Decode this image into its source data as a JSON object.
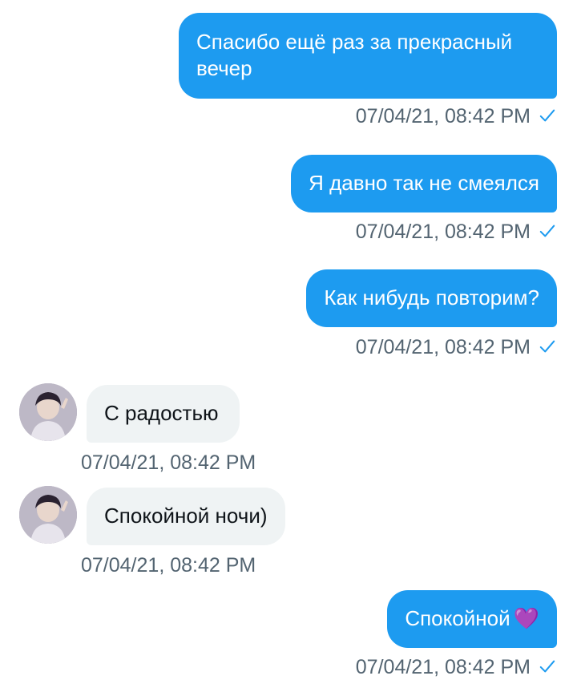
{
  "colors": {
    "outgoing_bubble": "#1d9bf0",
    "incoming_bubble": "#eff3f4",
    "timestamp_text": "#536471",
    "read_check": "#1d9bf0",
    "heart": "#7a3fb8"
  },
  "messages": [
    {
      "direction": "outgoing",
      "text": "Спасибо ещё раз за прекрасный вечер",
      "timestamp": "07/04/21, 08:42 PM",
      "read_icon": "checkmark-icon"
    },
    {
      "direction": "outgoing",
      "text": "Я давно так не смеялся",
      "timestamp": "07/04/21, 08:42 PM",
      "read_icon": "checkmark-icon"
    },
    {
      "direction": "outgoing",
      "text": "Как нибудь повторим?",
      "timestamp": "07/04/21, 08:42 PM",
      "read_icon": "checkmark-icon"
    },
    {
      "direction": "incoming",
      "text": "С радостью",
      "timestamp": "07/04/21, 08:42 PM",
      "avatar_icon": "user-avatar"
    },
    {
      "direction": "incoming",
      "text": "Спокойной ночи)",
      "timestamp": "07/04/21, 08:42 PM",
      "avatar_icon": "user-avatar"
    },
    {
      "direction": "outgoing",
      "text": "Спокойной",
      "emoji": "💜",
      "timestamp": "07/04/21, 08:42 PM",
      "read_icon": "checkmark-icon"
    }
  ]
}
